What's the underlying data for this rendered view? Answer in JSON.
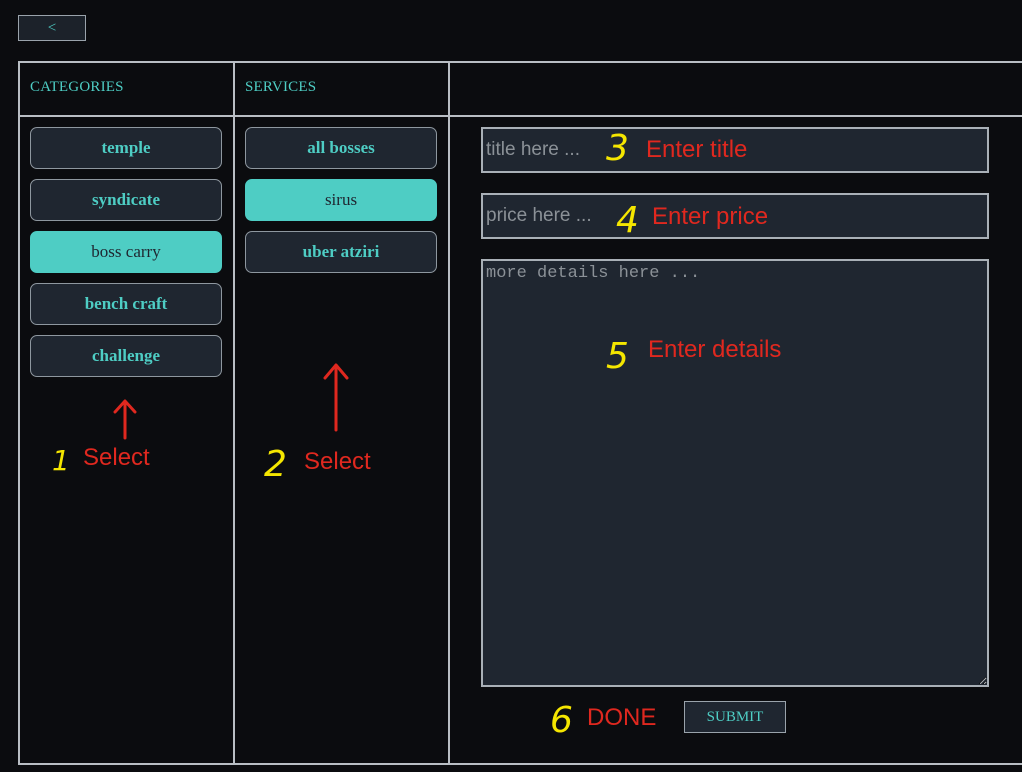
{
  "back_button": {
    "label": "<"
  },
  "categories": {
    "header": "CATEGORIES",
    "items": [
      {
        "label": "temple",
        "selected": false
      },
      {
        "label": "syndicate",
        "selected": false
      },
      {
        "label": "boss carry",
        "selected": true
      },
      {
        "label": "bench craft",
        "selected": false
      },
      {
        "label": "challenge",
        "selected": false
      }
    ]
  },
  "services": {
    "header": "SERVICES",
    "items": [
      {
        "label": "all bosses",
        "selected": false
      },
      {
        "label": "sirus",
        "selected": true
      },
      {
        "label": "uber atziri",
        "selected": false
      }
    ]
  },
  "form": {
    "title_placeholder": "title here ...",
    "price_placeholder": "price here ...",
    "details_placeholder": "more details here ...",
    "submit_label": "SUBMIT"
  },
  "annotations": {
    "step1_number": "1",
    "step1_text": "Select",
    "step2_number": "2",
    "step2_text": "Select",
    "step3_number": "3",
    "step3_text": "Enter title",
    "step4_number": "4",
    "step4_text": "Enter price",
    "step5_number": "5",
    "step5_text": "Enter details",
    "step6_number": "6",
    "step6_text": "DONE"
  },
  "colors": {
    "accent": "#4ecdc4",
    "background": "#0b0c0f",
    "panel": "#1f2630",
    "annotation_text": "#e0281f",
    "annotation_number": "#f5e600"
  }
}
